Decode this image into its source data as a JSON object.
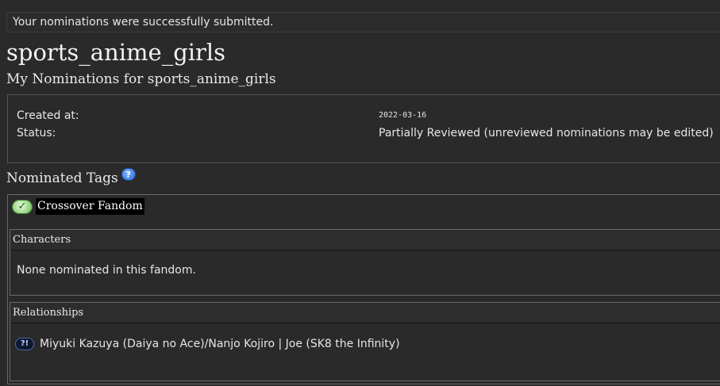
{
  "flash": {
    "message": "Your nominations were successfully submitted."
  },
  "page": {
    "title": "sports_anime_girls",
    "subtitle": "My Nominations for sports_anime_girls"
  },
  "meta": {
    "created_label": "Created at:",
    "created_value": "2022-03-16",
    "status_label": "Status:",
    "status_value": "Partially Reviewed (unreviewed nominations may be edited)"
  },
  "nominated_tags": {
    "heading": "Nominated Tags",
    "help_icon": "help-icon",
    "help_glyph": "?"
  },
  "fandom": {
    "status_icon": "check-icon",
    "status_glyph": "✓",
    "name": "Crossover Fandom",
    "characters": {
      "heading": "Characters",
      "empty_text": "None nominated in this fandom."
    },
    "relationships": {
      "heading": "Relationships",
      "items": [
        {
          "status_icon": "unreviewed-icon",
          "status_glyph": "?!",
          "name": "Miyuki Kazuya (Daiya no Ace)/Nanjo Kojiro | Joe (SK8 the Infinity)"
        }
      ]
    }
  }
}
